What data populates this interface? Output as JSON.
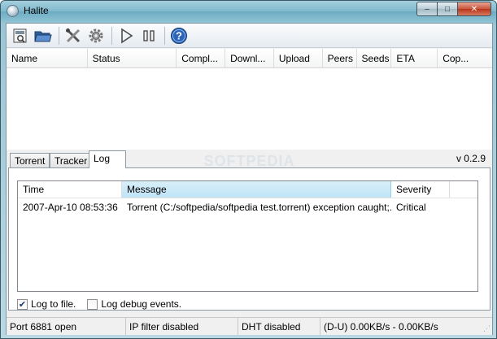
{
  "window": {
    "title": "Halite",
    "minimize_symbol": "–",
    "maximize_symbol": "□",
    "close_symbol": "✕"
  },
  "toolbar": {
    "icons": [
      "open-torrent-icon",
      "open-folder-icon",
      "tools-icon",
      "settings-gear-icon",
      "resume-play-icon",
      "pause-icon",
      "help-icon"
    ]
  },
  "torrent_list": {
    "columns": [
      "Name",
      "Status",
      "Compl...",
      "Downl...",
      "Upload",
      "Peers",
      "Seeds",
      "ETA",
      "Cop..."
    ],
    "watermark": "SOFTPEDIA"
  },
  "tabs": {
    "items": [
      "Torrent",
      "Tracker",
      "Log"
    ],
    "active": "Log"
  },
  "version": "v 0.2.9",
  "log": {
    "columns": [
      "Time",
      "Message",
      "Severity"
    ],
    "rows": [
      {
        "time": "2007-Apr-10 08:53:36",
        "message": "Torrent (C:/softpedia/softpedia test.torrent) exception caught;...",
        "severity": "Critical"
      }
    ],
    "log_to_file_label": "Log to file.",
    "log_to_file_checked": true,
    "log_debug_label": "Log debug events.",
    "log_debug_checked": false
  },
  "statusbar": {
    "port": "Port 6881 open",
    "ip_filter": "IP filter disabled",
    "dht": "DHT disabled",
    "rates": "(D-U) 0.00KB/s - 0.00KB/s"
  }
}
